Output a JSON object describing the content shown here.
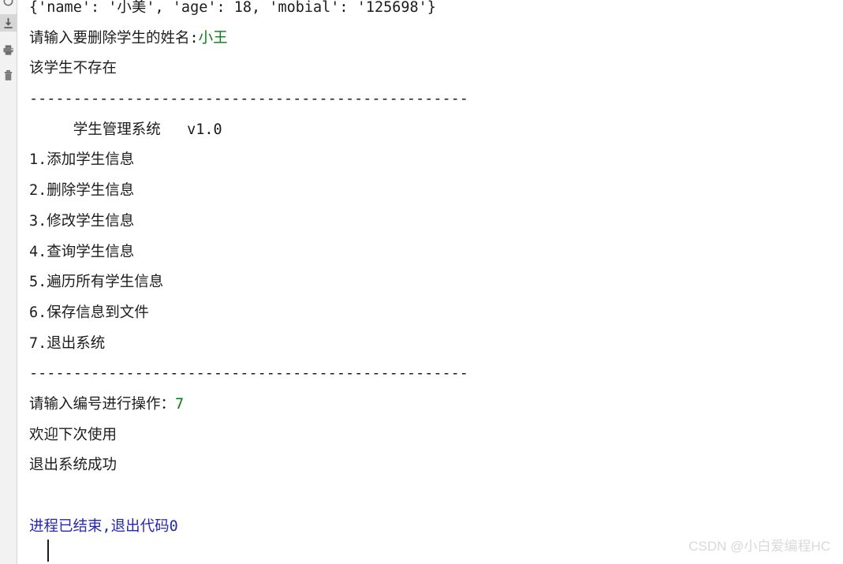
{
  "toolbar": {
    "buttons": [
      {
        "name": "rerun-icon",
        "title": "Rerun",
        "active": false
      },
      {
        "name": "scroll-to-end-icon",
        "title": "Scroll to End",
        "active": true
      },
      {
        "name": "print-icon",
        "title": "Print",
        "active": false
      },
      {
        "name": "trash-icon",
        "title": "Clear All",
        "active": false
      }
    ]
  },
  "console": {
    "lines": [
      {
        "segments": [
          {
            "text": "{'name': '小美', 'age': 18, 'mobial': '125698'}",
            "style": "default"
          }
        ]
      },
      {
        "segments": [
          {
            "text": "请输入要删除学生的姓名:",
            "style": "default"
          },
          {
            "text": "小王",
            "style": "input"
          }
        ]
      },
      {
        "segments": [
          {
            "text": "该学生不存在",
            "style": "default"
          }
        ]
      },
      {
        "segments": [
          {
            "text": "--------------------------------------------------",
            "style": "default"
          }
        ]
      },
      {
        "segments": [
          {
            "text": "     学生管理系统   v1.0",
            "style": "default"
          }
        ]
      },
      {
        "segments": [
          {
            "text": "1.添加学生信息",
            "style": "default"
          }
        ]
      },
      {
        "segments": [
          {
            "text": "2.删除学生信息",
            "style": "default"
          }
        ]
      },
      {
        "segments": [
          {
            "text": "3.修改学生信息",
            "style": "default"
          }
        ]
      },
      {
        "segments": [
          {
            "text": "4.查询学生信息",
            "style": "default"
          }
        ]
      },
      {
        "segments": [
          {
            "text": "5.遍历所有学生信息",
            "style": "default"
          }
        ]
      },
      {
        "segments": [
          {
            "text": "6.保存信息到文件",
            "style": "default"
          }
        ]
      },
      {
        "segments": [
          {
            "text": "7.退出系统",
            "style": "default"
          }
        ]
      },
      {
        "segments": [
          {
            "text": "--------------------------------------------------",
            "style": "default"
          }
        ]
      },
      {
        "segments": [
          {
            "text": "请输入编号进行操作：",
            "style": "default"
          },
          {
            "text": "7",
            "style": "input"
          }
        ]
      },
      {
        "segments": [
          {
            "text": "欢迎下次使用",
            "style": "default"
          }
        ]
      },
      {
        "segments": [
          {
            "text": "退出系统成功",
            "style": "default"
          }
        ]
      },
      {
        "segments": [
          {
            "text": "",
            "style": "default"
          }
        ]
      },
      {
        "segments": [
          {
            "text": "进程已结束,退出代码0",
            "style": "exit"
          }
        ]
      }
    ]
  },
  "watermark": {
    "text": "CSDN @小白爱编程HC"
  },
  "colors": {
    "text": "#1c1c1c",
    "user_input": "#0a7d15",
    "exit_message": "#2626b0",
    "background": "#ffffff",
    "toolstrip": "#f2f2f2",
    "toolstrip_active": "#d6d6d6",
    "watermark": "#d9d9d9"
  }
}
